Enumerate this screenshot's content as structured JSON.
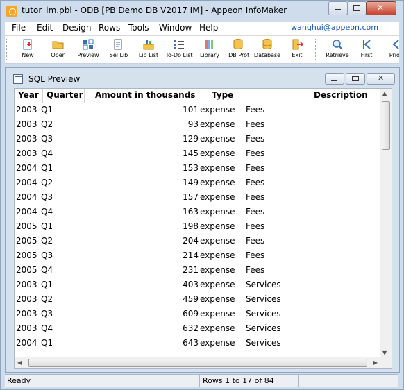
{
  "window": {
    "title": "tutor_im.pbl - ODB [PB Demo DB V2017 IM]  - Appeon InfoMaker",
    "min_label": "minimize",
    "max_label": "maximize",
    "close_glyph": "✕"
  },
  "menu": {
    "items": [
      "File",
      "Edit",
      "Design",
      "Rows",
      "Tools",
      "Window",
      "Help"
    ],
    "user": "wanghui@appeon.com"
  },
  "toolbar": {
    "buttons": [
      {
        "label": "New",
        "icon": "new-icon"
      },
      {
        "label": "Open",
        "icon": "open-folder-icon"
      },
      {
        "label": "Preview",
        "icon": "preview-icon"
      },
      {
        "label": "Sel Lib",
        "icon": "select-library-icon"
      },
      {
        "label": "Lib List",
        "icon": "library-list-icon"
      },
      {
        "label": "To-Do List",
        "icon": "todo-list-icon"
      },
      {
        "label": "Library",
        "icon": "library-icon"
      },
      {
        "label": "DB Prof",
        "icon": "db-profile-icon"
      },
      {
        "label": "Database",
        "icon": "database-icon"
      },
      {
        "label": "Exit",
        "icon": "exit-icon"
      },
      {
        "label": "Retrieve",
        "icon": "retrieve-icon"
      },
      {
        "label": "First",
        "icon": "first-record-icon"
      },
      {
        "label": "Prior",
        "icon": "prior-record-icon"
      }
    ]
  },
  "child_window": {
    "title": "SQL Preview",
    "close_glyph": "✕"
  },
  "grid": {
    "columns": [
      "Year",
      "Quarter",
      "Amount in thousands",
      "Type",
      "Description"
    ],
    "rows": [
      [
        "2003",
        "Q1",
        "101",
        "expense",
        "Fees"
      ],
      [
        "2003",
        "Q2",
        "93",
        "expense",
        "Fees"
      ],
      [
        "2003",
        "Q3",
        "129",
        "expense",
        "Fees"
      ],
      [
        "2003",
        "Q4",
        "145",
        "expense",
        "Fees"
      ],
      [
        "2004",
        "Q1",
        "153",
        "expense",
        "Fees"
      ],
      [
        "2004",
        "Q2",
        "149",
        "expense",
        "Fees"
      ],
      [
        "2004",
        "Q3",
        "157",
        "expense",
        "Fees"
      ],
      [
        "2004",
        "Q4",
        "163",
        "expense",
        "Fees"
      ],
      [
        "2005",
        "Q1",
        "198",
        "expense",
        "Fees"
      ],
      [
        "2005",
        "Q2",
        "204",
        "expense",
        "Fees"
      ],
      [
        "2005",
        "Q3",
        "214",
        "expense",
        "Fees"
      ],
      [
        "2005",
        "Q4",
        "231",
        "expense",
        "Fees"
      ],
      [
        "2003",
        "Q1",
        "403",
        "expense",
        "Services"
      ],
      [
        "2003",
        "Q2",
        "459",
        "expense",
        "Services"
      ],
      [
        "2003",
        "Q3",
        "609",
        "expense",
        "Services"
      ],
      [
        "2003",
        "Q4",
        "632",
        "expense",
        "Services"
      ],
      [
        "2004",
        "Q1",
        "643",
        "expense",
        "Services"
      ]
    ]
  },
  "status": {
    "left": "Ready",
    "rows": "Rows 1 to 17 of 84"
  },
  "colors": {
    "frame": "#cfdcec",
    "link": "#1a58b5",
    "close_red": "#c7432c"
  }
}
